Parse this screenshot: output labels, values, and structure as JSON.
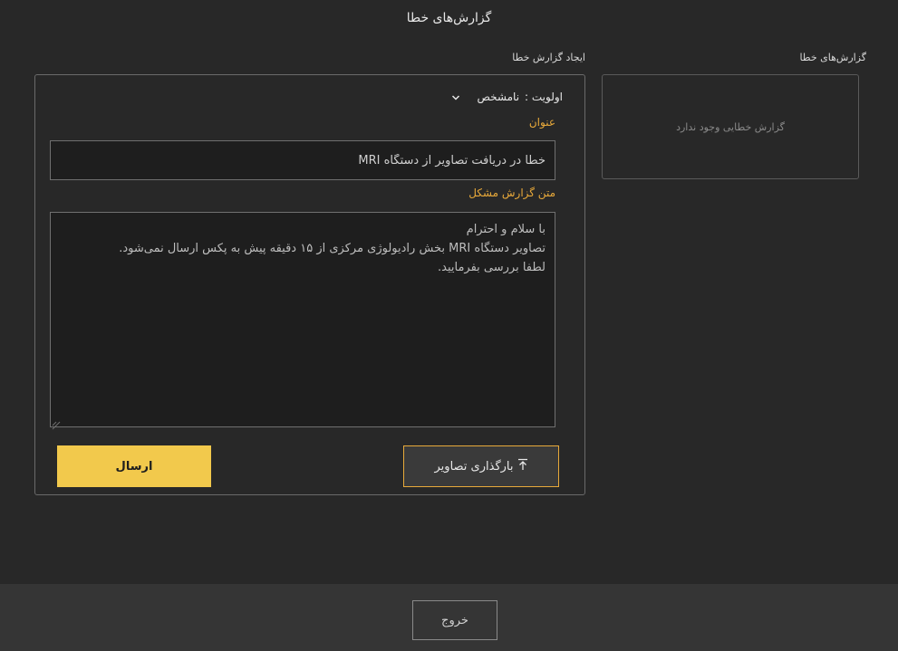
{
  "page": {
    "title": "گزارش‌های خطا"
  },
  "reports": {
    "label": "گزارش‌های خطا",
    "empty_text": "گزارش خطایی وجود ندارد"
  },
  "create": {
    "label": "ایجاد گزارش خطا",
    "priority_label": "اولویت :",
    "priority_value": "نامشخص",
    "title_label": "عنوان",
    "title_value": "خطا در دریافت تصاویر از دستگاه MRI",
    "body_label": "متن گزارش مشکل",
    "body_value": "با سلام و احترام\nتصاویر دستگاه MRI بخش رادیولوژی مرکزی از ۱۵ دقیقه پیش به پکس ارسال نمی‌شود.\nلطفا بررسی بفرمایید.",
    "upload_label": "بارگذاری تصاویر",
    "send_label": "ارسال"
  },
  "footer": {
    "exit_label": "خروج"
  },
  "colors": {
    "background": "#282828",
    "accent": "#e8a93a",
    "send_button": "#f2c94c",
    "footer": "#353535"
  },
  "icons": {
    "priority_dropdown": "chevron-down-icon",
    "upload": "upload-icon",
    "textarea_grip": "resize-grip-icon"
  }
}
